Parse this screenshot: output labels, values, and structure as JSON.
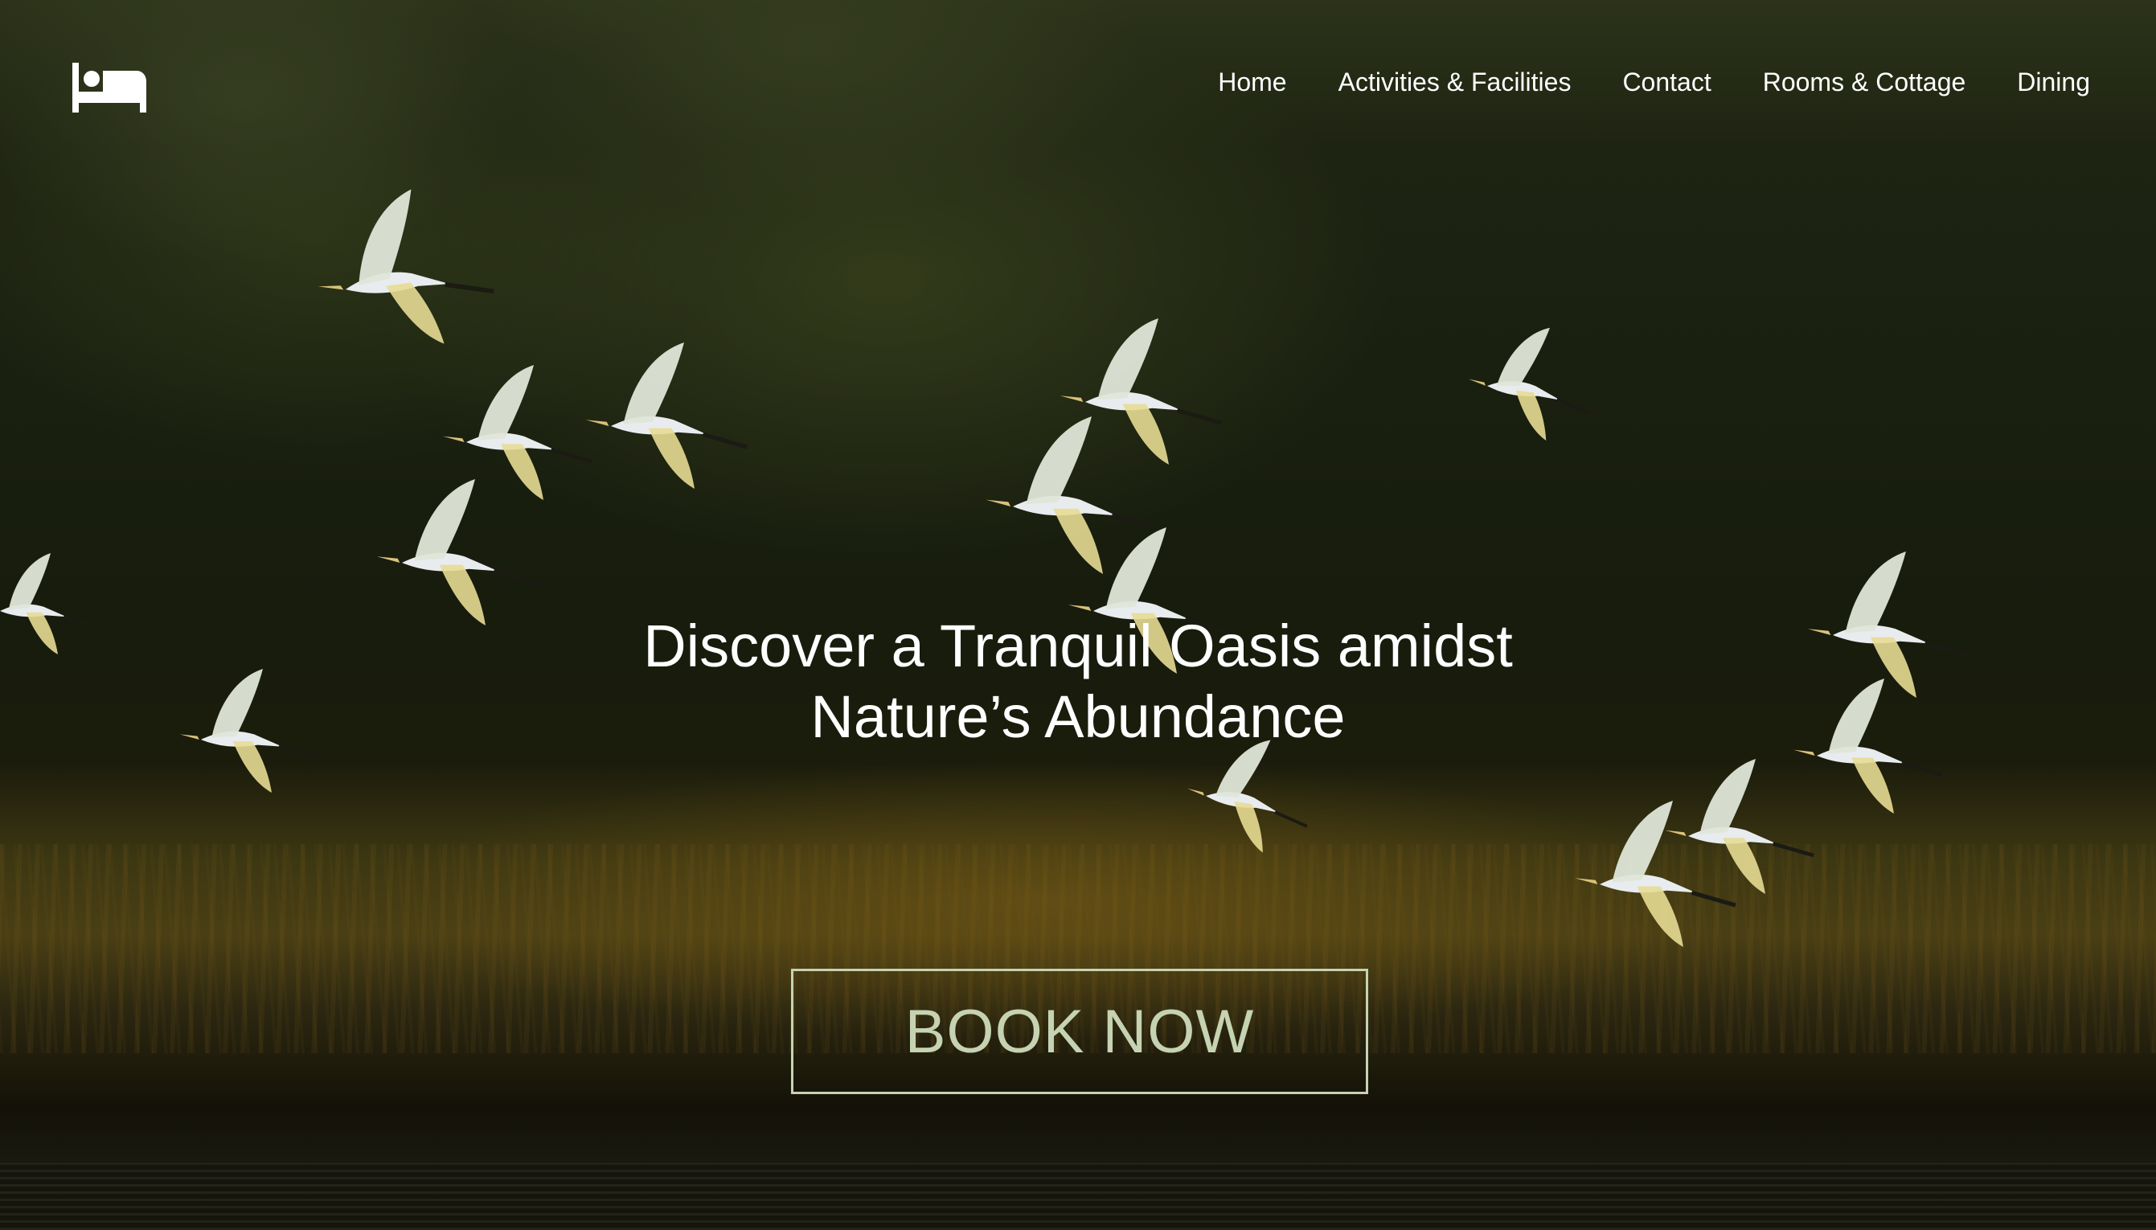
{
  "brand": {
    "logo_icon": "bed-icon"
  },
  "nav": {
    "items": [
      {
        "label": "Home"
      },
      {
        "label": "Activities & Facilities"
      },
      {
        "label": "Contact"
      },
      {
        "label": "Rooms & Cottage"
      },
      {
        "label": "Dining"
      }
    ]
  },
  "hero": {
    "headline_line1": "Discover a Tranquil Oasis amidst",
    "headline_line2": "Nature’s Abundance",
    "cta_label": "BOOK NOW",
    "background": "hero-photo-egrets-flying-over-wetland"
  },
  "colors": {
    "text": "#ffffff",
    "cta": "#c6d3b3"
  }
}
